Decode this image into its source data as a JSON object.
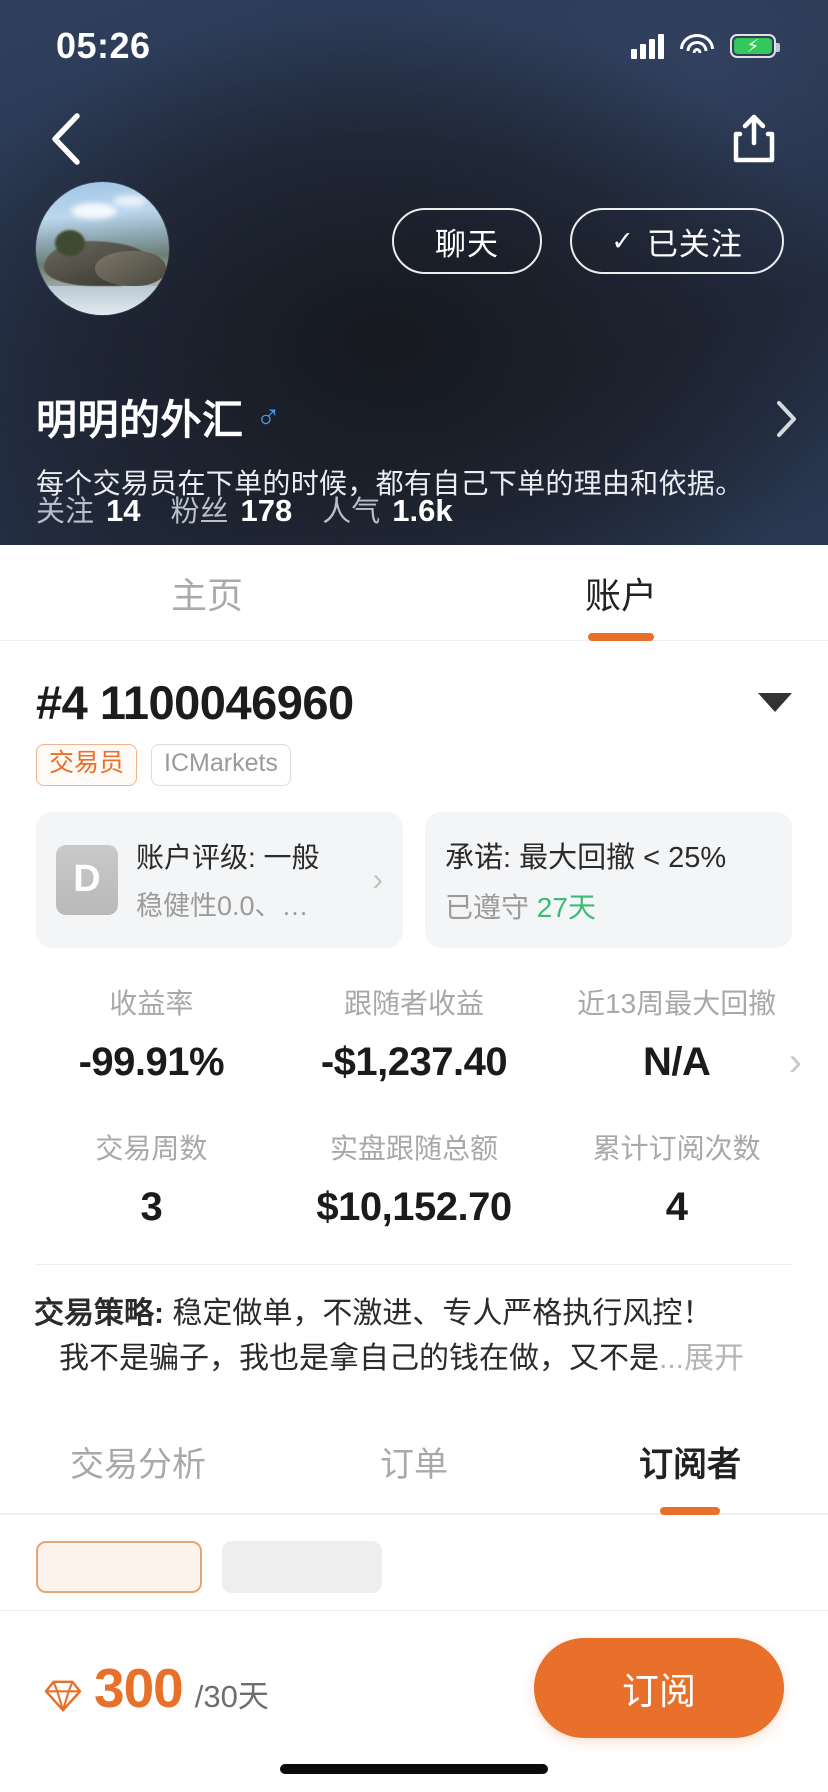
{
  "status_bar": {
    "time": "05:26",
    "signal_icon": "cellular-signal-icon",
    "wifi_icon": "wifi-icon",
    "battery_icon": "battery-charging-icon"
  },
  "nav": {
    "back_icon": "back-chevron-icon",
    "share_icon": "share-icon"
  },
  "profile": {
    "avatar_icon": "user-avatar",
    "nickname": "明明的外汇",
    "gender_symbol": "♂",
    "bio": "每个交易员在下单的时候，都有自己下单的理由和依据。…",
    "chat_button": "聊天",
    "follow_button": "已关注",
    "follow_check": "✓",
    "chevron_icon": "chevron-right-icon",
    "stats": [
      {
        "label": "关注",
        "value": "14"
      },
      {
        "label": "粉丝",
        "value": "178"
      },
      {
        "label": "人气",
        "value": "1.6k"
      }
    ]
  },
  "top_tabs": [
    {
      "label": "主页",
      "active": false
    },
    {
      "label": "账户",
      "active": true
    }
  ],
  "account": {
    "number": "#4 1100046960",
    "dropdown_icon": "caret-down-icon",
    "badges": [
      {
        "label": "交易员",
        "type": "trader"
      },
      {
        "label": "ICMarkets",
        "type": "broker"
      }
    ],
    "rating_card": {
      "grade": "D",
      "title": "账户评级: 一般",
      "subtitle": "稳健性0.0、…",
      "chevron_icon": "chevron-right-icon"
    },
    "promise_card": {
      "title": "承诺: 最大回撤 < 25%",
      "prefix": "已遵守",
      "days": "27天"
    },
    "stats_row_1": [
      {
        "label": "收益率",
        "value": "-99.91%"
      },
      {
        "label": "跟随者收益",
        "value": "-$1,237.40"
      },
      {
        "label": "近13周最大回撤",
        "value": "N/A"
      }
    ],
    "stats_row_2": [
      {
        "label": "交易周数",
        "value": "3"
      },
      {
        "label": "实盘跟随总额",
        "value": "$10,152.70"
      },
      {
        "label": "累计订阅次数",
        "value": "4"
      }
    ],
    "stats_chevron_icon": "chevron-right-icon",
    "strategy": {
      "label": "交易策略:",
      "line1": " 稳定做单，不激进、专人严格执行风控！",
      "line2": "我不是骗子，我也是拿自己的钱在做，又不是",
      "ellipsis": "...",
      "expand": "展开"
    }
  },
  "bottom_tabs": [
    {
      "label": "交易分析",
      "active": false
    },
    {
      "label": "订单",
      "active": false
    },
    {
      "label": "订阅者",
      "active": true
    }
  ],
  "bottom_bar": {
    "gem_icon": "diamond-icon",
    "price": "300",
    "price_unit": "/30天",
    "subscribe_button": "订阅",
    "accent_color": "#e8702a"
  }
}
